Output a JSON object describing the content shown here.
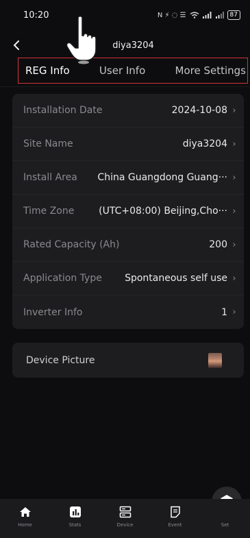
{
  "status_bar": {
    "time": "10:20",
    "indicators": "N ⚡ ◌ ☰",
    "battery": "87"
  },
  "header": {
    "back_icon": "chevron-left-icon",
    "title": "diya3204"
  },
  "tabs": [
    {
      "label": "REG Info",
      "active": true
    },
    {
      "label": "User Info",
      "active": false
    },
    {
      "label": "More Settings",
      "active": false
    }
  ],
  "info_rows": [
    {
      "label": "Installation Date",
      "value": "2024-10-08"
    },
    {
      "label": "Site Name",
      "value": "diya3204"
    },
    {
      "label": "Install Area",
      "value": "China Guangdong Guang···"
    },
    {
      "label": "Time Zone",
      "value": "(UTC+08:00) Beijing,Cho···"
    },
    {
      "label": "Rated Capacity (Ah)",
      "value": "200"
    },
    {
      "label": "Application Type",
      "value": "Spontaneous self use"
    },
    {
      "label": "Inverter Info",
      "value": "1"
    }
  ],
  "device_picture": {
    "label": "Device Picture"
  },
  "bottom_nav": [
    {
      "label": "Home",
      "icon": "home-icon"
    },
    {
      "label": "Stats",
      "icon": "stats-icon"
    },
    {
      "label": "Device",
      "icon": "device-icon"
    },
    {
      "label": "Event",
      "icon": "event-icon"
    },
    {
      "label": "Set",
      "icon": "settings-icon"
    }
  ],
  "colors": {
    "background": "#0d0d0f",
    "card": "#1d1d20",
    "highlight_border": "#d0343a",
    "muted_text": "#8a8a8e"
  }
}
